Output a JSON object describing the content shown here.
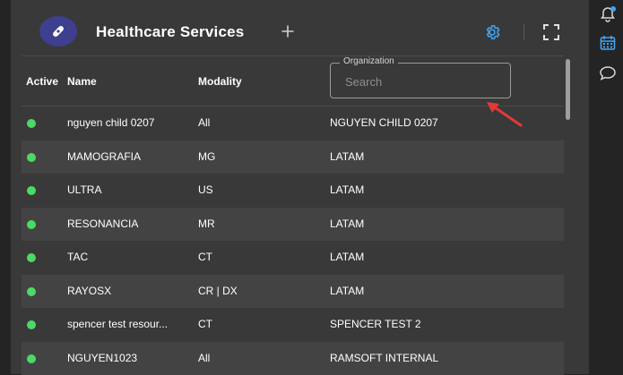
{
  "header": {
    "title": "Healthcare Services",
    "logo_icon": "healthcare-logo-icon",
    "add_icon": "plus-icon",
    "settings_icon": "gear-icon",
    "fullscreen_icon": "fullscreen-icon"
  },
  "table": {
    "columns": {
      "active": "Active",
      "name": "Name",
      "modality": "Modality"
    },
    "organization_filter": {
      "label": "Organization",
      "placeholder": "Search",
      "value": ""
    },
    "rows": [
      {
        "active": true,
        "name": "nguyen child 0207",
        "modality": "All",
        "organization": "NGUYEN CHILD 0207"
      },
      {
        "active": true,
        "name": "MAMOGRAFIA",
        "modality": "MG",
        "organization": "LATAM"
      },
      {
        "active": true,
        "name": "ULTRA",
        "modality": "US",
        "organization": "LATAM"
      },
      {
        "active": true,
        "name": "RESONANCIA",
        "modality": "MR",
        "organization": "LATAM"
      },
      {
        "active": true,
        "name": "TAC",
        "modality": "CT",
        "organization": "LATAM"
      },
      {
        "active": true,
        "name": "RAYOSX",
        "modality": "CR | DX",
        "organization": "LATAM"
      },
      {
        "active": true,
        "name": "spencer test resour...",
        "modality": "CT",
        "organization": "SPENCER TEST 2"
      },
      {
        "active": true,
        "name": "NGUYEN1023",
        "modality": "All",
        "organization": "RAMSOFT INTERNAL"
      }
    ]
  },
  "sidebar": {
    "items": [
      {
        "icon": "bell-icon",
        "has_badge": true
      },
      {
        "icon": "calendar-icon",
        "selected": true
      },
      {
        "icon": "chat-icon"
      }
    ]
  },
  "colors": {
    "background": "#242424",
    "panel": "#393939",
    "row_alt": "#434343",
    "active_dot": "#4cd964",
    "accent": "#42a5f5",
    "logo_bg": "#3e3f8f",
    "annotation_arrow": "#e53935"
  }
}
